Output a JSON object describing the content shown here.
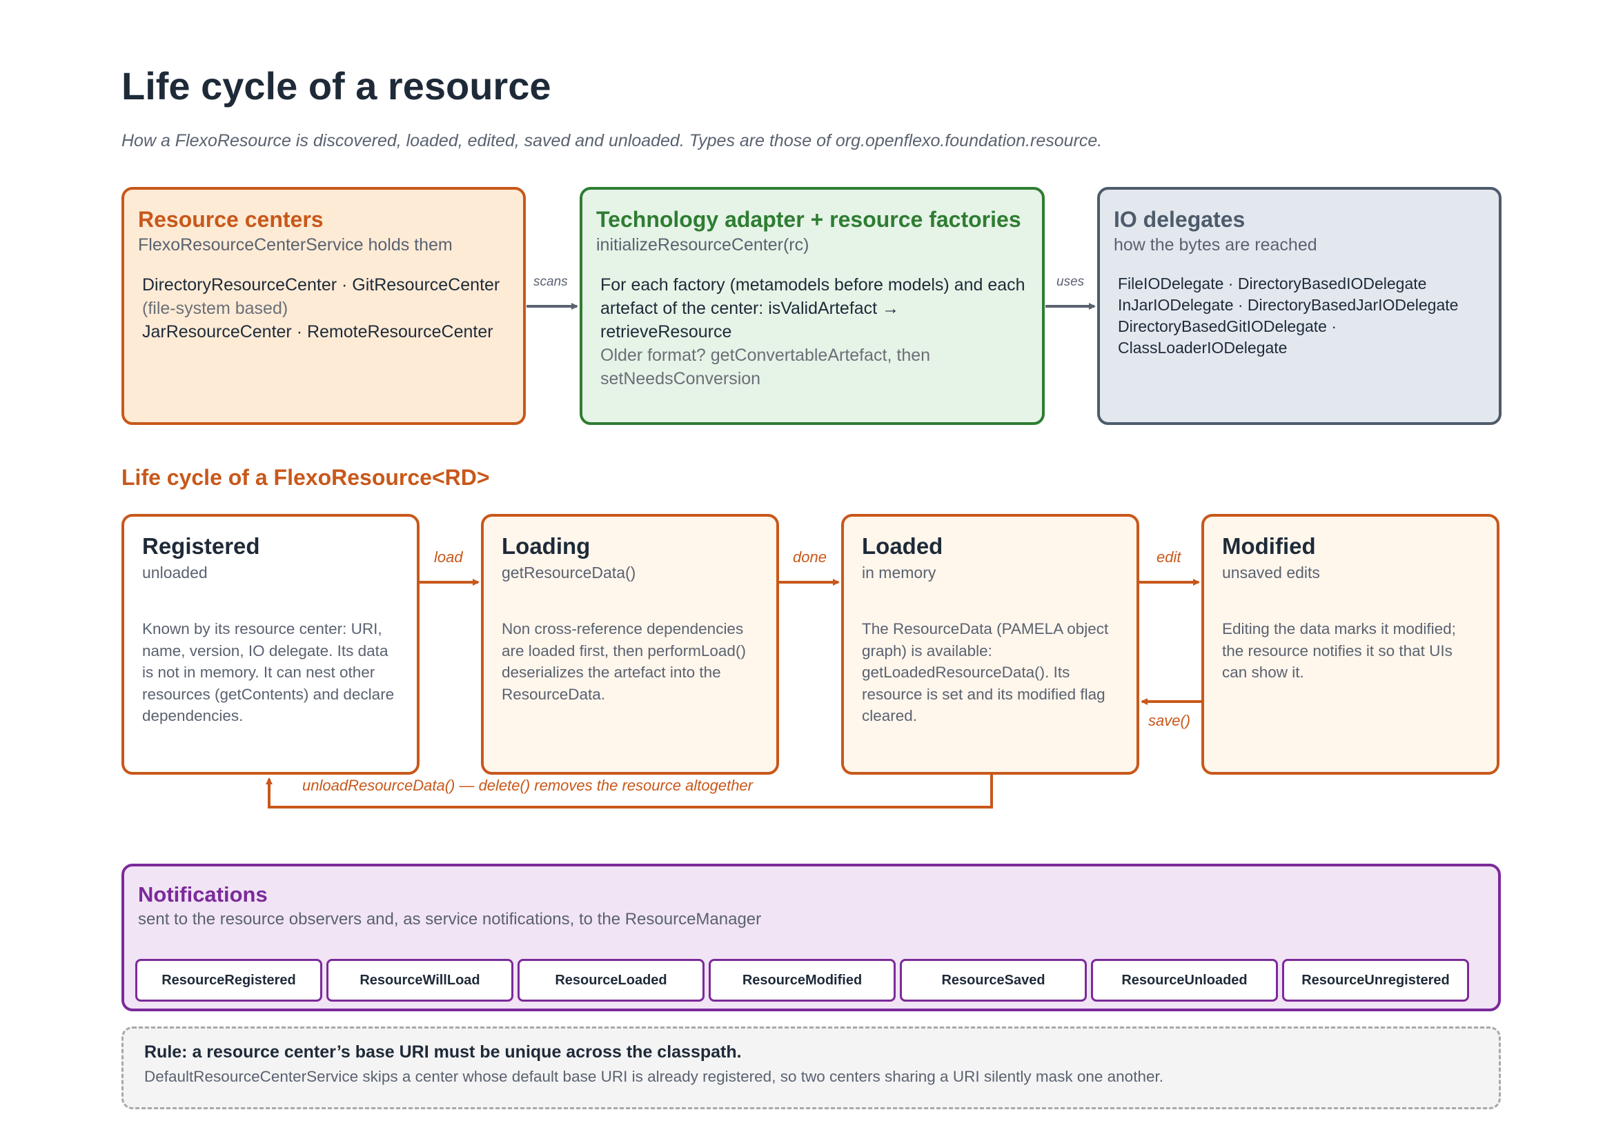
{
  "title": "Life cycle of a resource",
  "subtitle": "How a FlexoResource is discovered, loaded, edited, saved and unloaded. Types are those of org.openflexo.foundation.resource.",
  "panels": {
    "resource_centers": {
      "title": "Resource centers",
      "subtitle": "FlexoResourceCenterService holds them",
      "line1": "DirectoryResourceCenter · GitResourceCenter",
      "line2": "(file-system based)",
      "line3": "JarResourceCenter · RemoteResourceCenter"
    },
    "technology_adapter": {
      "title": "Technology adapter + resource factories",
      "subtitle": "initializeResourceCenter(rc)",
      "line1": "For each factory (metamodels before models) and each artefact of the center: isValidArtefact → retrieveResource",
      "line2": "Older format? getConvertableArtefact, then setNeedsConversion"
    },
    "io_delegates": {
      "title": "IO delegates",
      "subtitle": "how the bytes are reached",
      "line1": "FileIODelegate · DirectoryBasedIODelegate",
      "line2": "InJarIODelegate · DirectoryBasedJarIODelegate",
      "line3": "DirectoryBasedGitIODelegate ·",
      "line4": "ClassLoaderIODelegate"
    }
  },
  "connectors": {
    "scans": "scans",
    "uses": "uses"
  },
  "lifecycle": {
    "heading": "Life cycle of a FlexoResource<RD>",
    "states": [
      {
        "title": "Registered",
        "subtitle": "unloaded",
        "description": "Known by its resource center: URI, name, version, IO delegate. Its data is not in memory. It can nest other resources (getContents) and declare dependencies."
      },
      {
        "title": "Loading",
        "subtitle": "getResourceData()",
        "description": "Non cross-reference dependencies are loaded first, then performLoad() deserializes the artefact into the ResourceData."
      },
      {
        "title": "Loaded",
        "subtitle": "in memory",
        "description": "The ResourceData (PAMELA object graph) is available: getLoadedResourceData(). Its resource is set and its modified flag cleared."
      },
      {
        "title": "Modified",
        "subtitle": "unsaved edits",
        "description": "Editing the data marks it modified; the resource notifies it so that UIs can show it."
      }
    ],
    "transitions": {
      "load": "load",
      "done": "done",
      "edit": "edit",
      "save": "save()",
      "unload": "unloadResourceData()  —  delete() removes the resource altogether"
    }
  },
  "notifications": {
    "title": "Notifications",
    "subtitle": "sent to the resource observers and, as service notifications, to the ResourceManager",
    "items": [
      "ResourceRegistered",
      "ResourceWillLoad",
      "ResourceLoaded",
      "ResourceModified",
      "ResourceSaved",
      "ResourceUnloaded",
      "ResourceUnregistered"
    ]
  },
  "rule": {
    "title": "Rule: a resource center’s base URI must be unique across the classpath.",
    "text": "DefaultResourceCenterService skips a center whose default base URI is already registered, so two centers sharing a URI silently mask one another."
  },
  "colors": {
    "orange": "#c8581a",
    "green": "#2e7d32",
    "slate": "#4d5b6b",
    "purple": "#7b2a9a"
  }
}
